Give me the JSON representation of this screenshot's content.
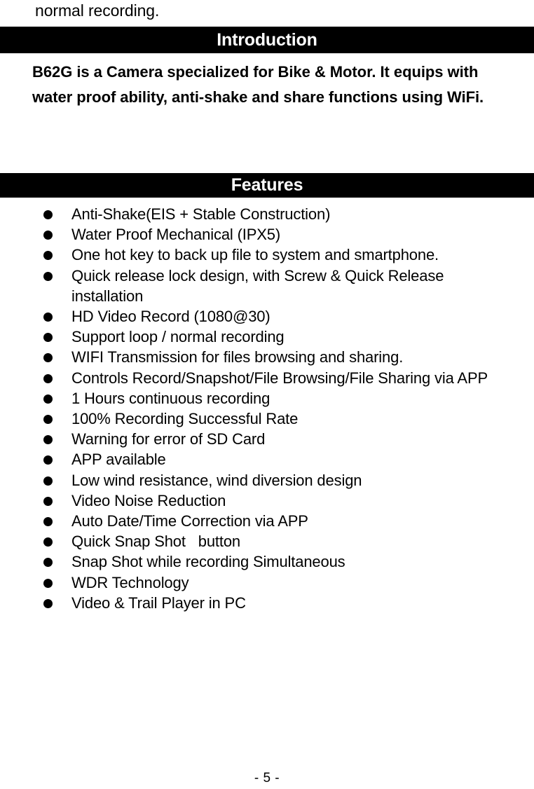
{
  "page": {
    "continuation_text": "normal recording.",
    "footer": "- 5 -"
  },
  "sections": {
    "introduction": {
      "heading": "Introduction",
      "body": "B62G is a Camera specialized for Bike & Motor. It equips with water proof ability, anti-shake and share functions using WiFi."
    },
    "features": {
      "heading": "Features",
      "bullet_icon": "filled-circle-bullet",
      "items": [
        "Anti-Shake(EIS + Stable Construction)",
        "Water Proof Mechanical (IPX5)",
        "One hot key to back up file to system and smartphone.",
        "Quick release lock design, with Screw & Quick Release installation",
        "HD Video Record (1080@30)",
        "Support loop / normal recording",
        "WIFI Transmission for files browsing and sharing.",
        "Controls Record/Snapshot/File Browsing/File Sharing via APP",
        "1 Hours continuous recording",
        "100% Recording Successful Rate",
        "Warning for error of SD Card",
        "APP available",
        "Low wind resistance, wind diversion design",
        "Video Noise Reduction",
        "Auto Date/Time Correction via APP",
        "Quick Snap Shot   button",
        "Snap Shot while recording Simultaneous",
        "WDR Technology",
        "Video & Trail Player in PC"
      ]
    }
  },
  "colors": {
    "page_background": "#ffffff",
    "text": "#000000",
    "section_bar_background": "#000000",
    "section_bar_text": "#ffffff"
  }
}
